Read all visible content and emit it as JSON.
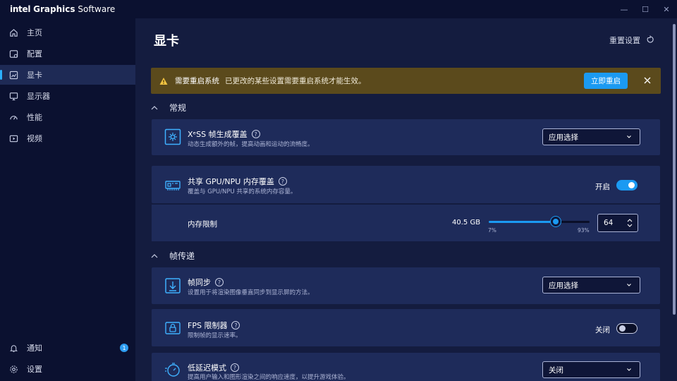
{
  "app": {
    "brand_intel": "intel",
    "brand_graphics": "Graphics",
    "brand_software": "Software"
  },
  "window_controls": {
    "minimize": "—",
    "maximize": "☐",
    "close": "✕"
  },
  "sidebar": {
    "items": [
      {
        "label": "主页",
        "icon": "home-icon"
      },
      {
        "label": "配置",
        "icon": "profile-icon"
      },
      {
        "label": "显卡",
        "icon": "graphics-icon",
        "active": true
      },
      {
        "label": "显示器",
        "icon": "monitor-icon"
      },
      {
        "label": "性能",
        "icon": "gauge-icon"
      },
      {
        "label": "视频",
        "icon": "video-icon"
      }
    ],
    "bottom": [
      {
        "label": "通知",
        "icon": "bell-icon",
        "badge": "1"
      },
      {
        "label": "设置",
        "icon": "gear-icon"
      }
    ]
  },
  "header": {
    "title": "显卡",
    "reset_label": "重置设置"
  },
  "warning": {
    "title": "需要重启系统",
    "message": "已更改的某些设置需要重启系统才能生效。",
    "button": "立即重启",
    "color": "#5b4a1c"
  },
  "sections": {
    "general": "常规",
    "frame_delivery": "帧传递"
  },
  "settings": {
    "xess": {
      "title": "XᵉSS 帧生成覆盖",
      "desc": "动态生成额外的帧，提高动画和运动的流畅度。",
      "value": "应用选择"
    },
    "shared_memory": {
      "title": "共享 GPU/NPU 内存覆盖",
      "desc": "覆盖与 GPU/NPU 共享的系统内存容量。",
      "toggle_label": "开启",
      "on": true
    },
    "memory_limit": {
      "label": "内存限制",
      "value_text": "40.5 GB",
      "min_label": "7%",
      "max_label": "93%",
      "min": 7,
      "max": 93,
      "value": 64,
      "input_value": "64"
    },
    "vsync": {
      "title": "帧同步",
      "desc": "设置用于将渲染图像垂直同步到显示屏的方法。",
      "value": "应用选择"
    },
    "fps_limiter": {
      "title": "FPS 限制器",
      "desc": "限制帧的显示速率。",
      "toggle_label": "关闭",
      "on": false
    },
    "low_latency": {
      "title": "低延迟模式",
      "desc": "提高用户输入和图形渲染之间的响应速度，以提升游戏体验。",
      "value": "关闭"
    }
  },
  "colors": {
    "accent": "#1b9af2",
    "background": "#141c3f",
    "card": "#1e2b5a",
    "sidebar": "#0b1130"
  }
}
